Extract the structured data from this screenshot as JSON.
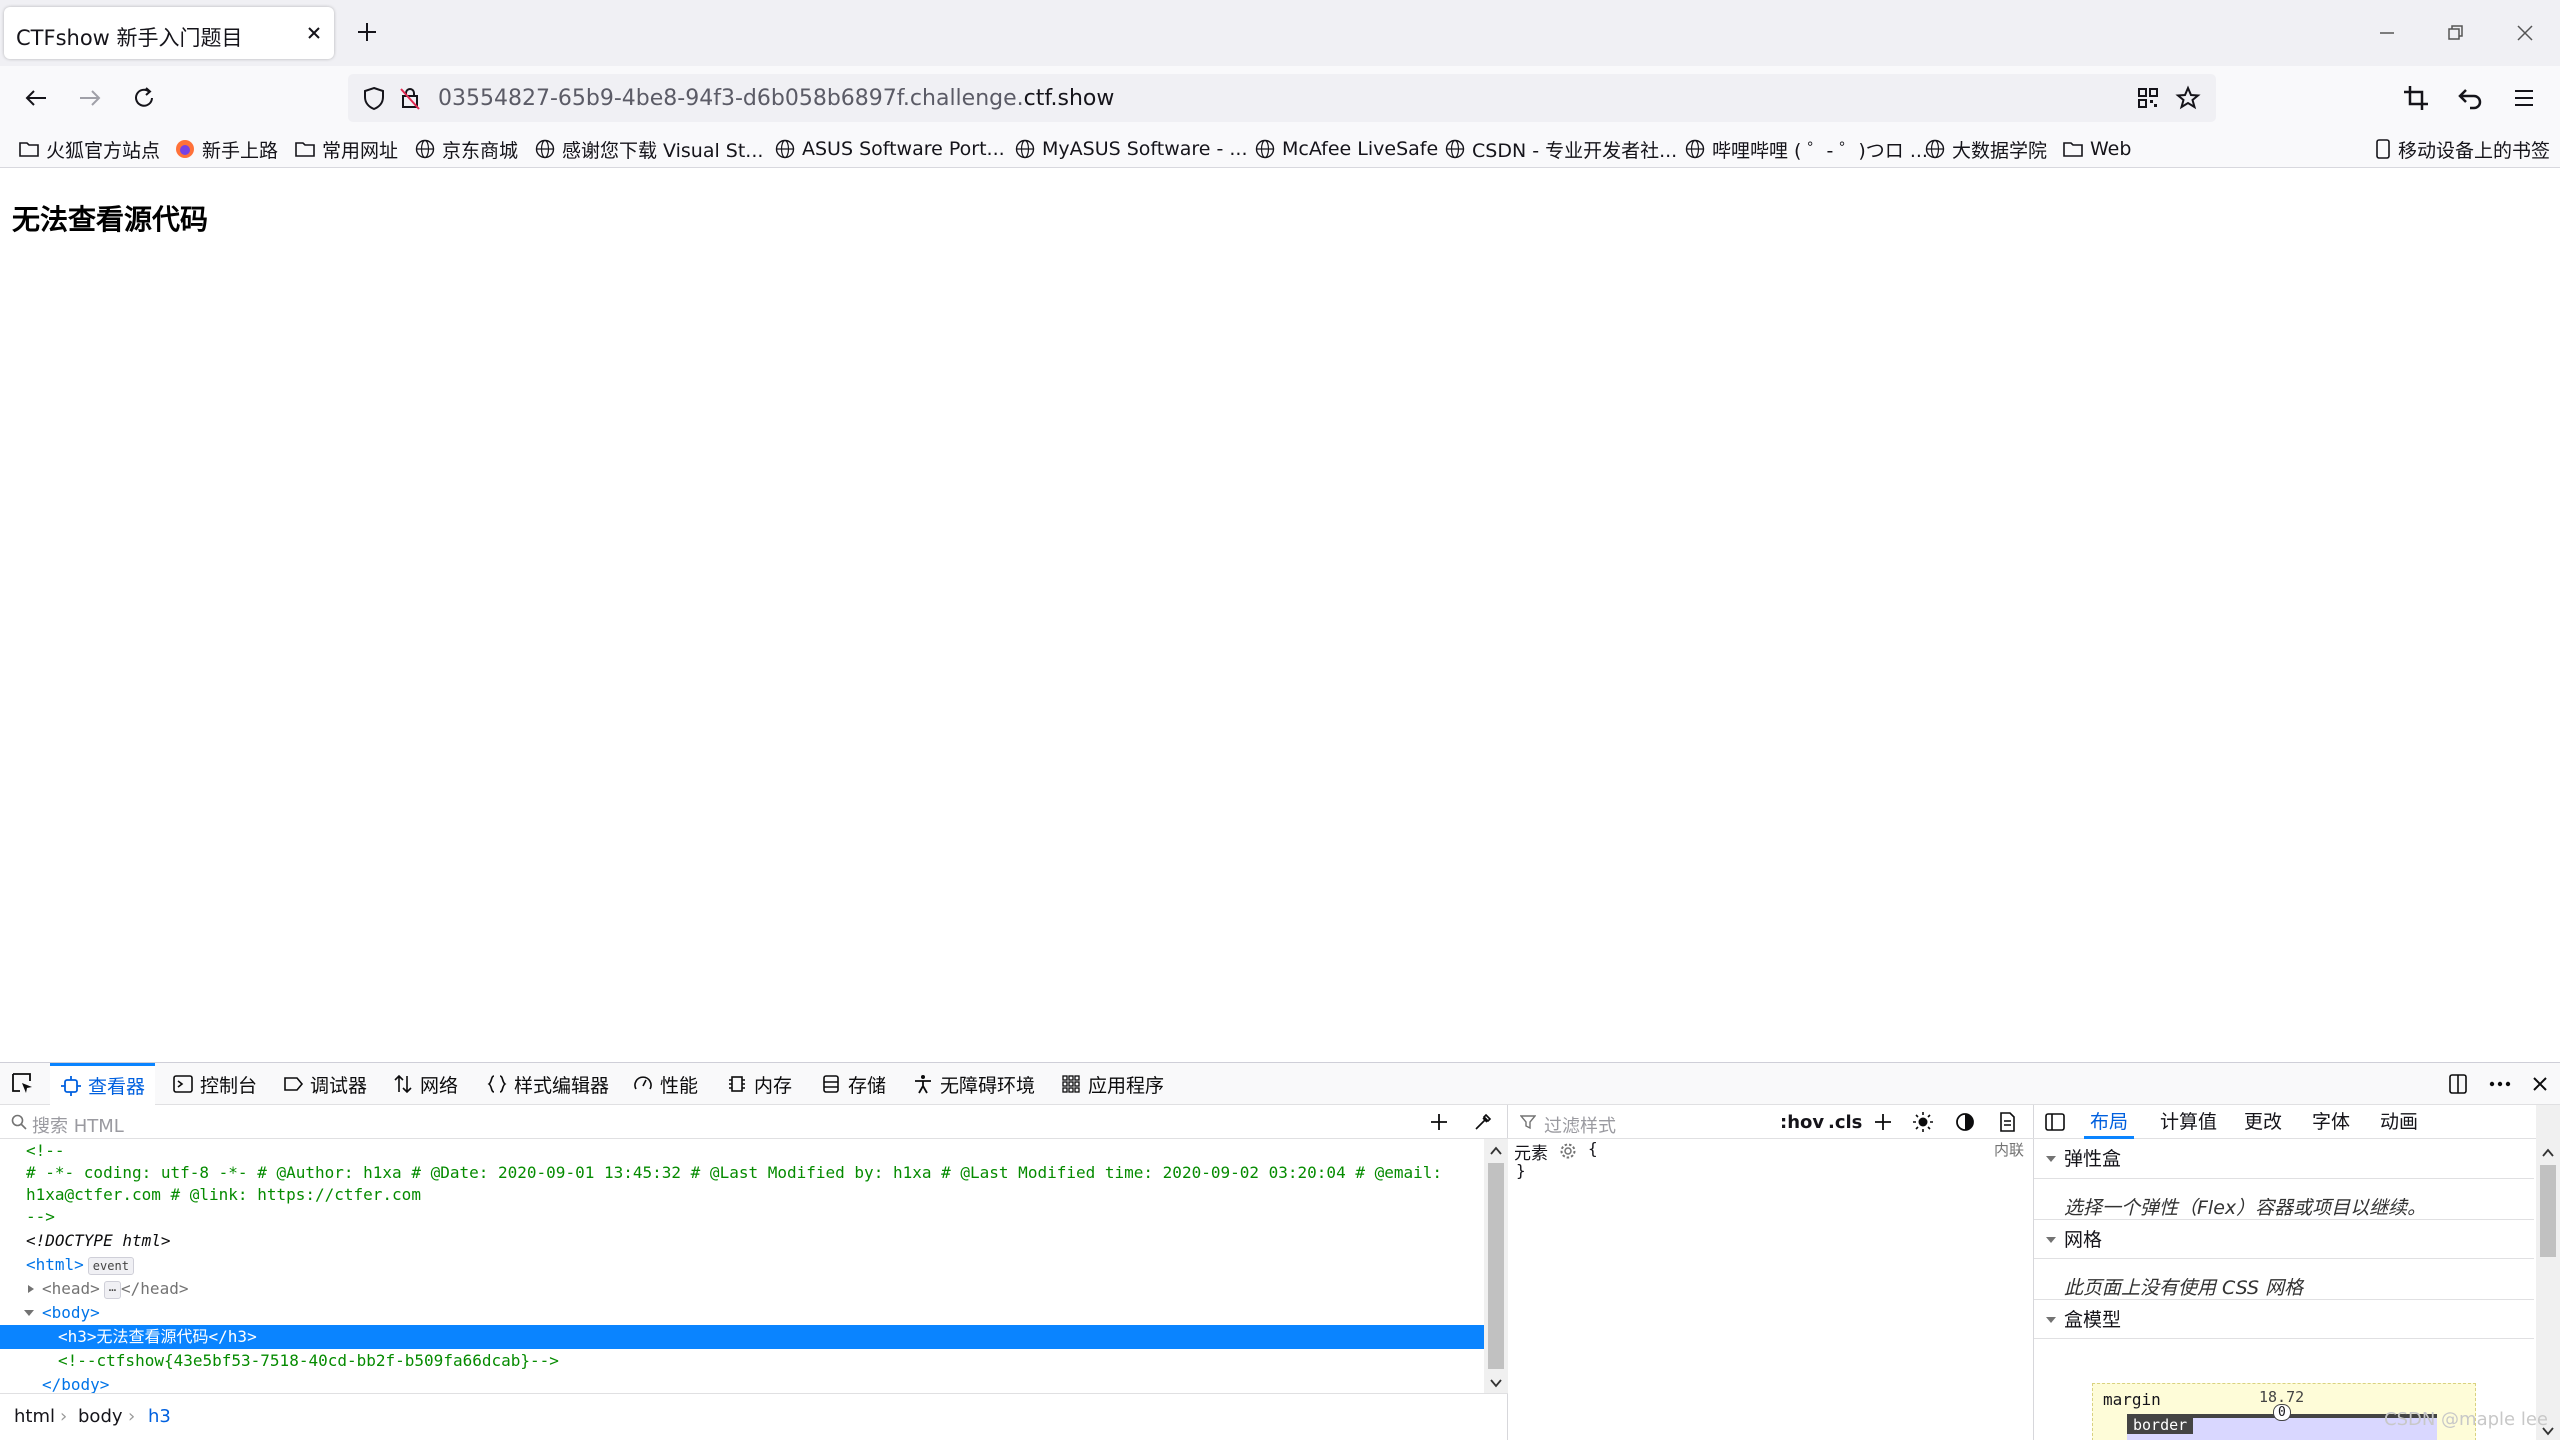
{
  "tab": {
    "title": "CTFshow 新手入门题目"
  },
  "urlbar": {
    "url_prefix": "03554827-65b9-4be8-94f3-d6b058b6897f.challenge.",
    "url_domain": "ctf.show"
  },
  "bookmarks": {
    "items": [
      "火狐官方站点",
      "新手上路",
      "常用网址",
      "京东商城",
      "感谢您下载 Visual St...",
      "ASUS Software Port...",
      "MyASUS Software - ...",
      "McAfee LiveSafe",
      "CSDN - 专业开发者社...",
      "哔哩哔哩 ( ゜- ゜)つロ ...",
      "大数据学院",
      "Web"
    ],
    "mobile": "移动设备上的书签"
  },
  "page": {
    "heading": "无法查看源代码"
  },
  "devtools": {
    "tabs": [
      "查看器",
      "控制台",
      "调试器",
      "网络",
      "样式编辑器",
      "性能",
      "内存",
      "存储",
      "无障碍环境",
      "应用程序"
    ],
    "search_placeholder": "搜索 HTML",
    "markup": {
      "comment_open": "<!--",
      "comment_line1": "# -*- coding: utf-8 -*- # @Author: h1xa # @Date: 2020-09-01 13:45:32 # @Last Modified by: h1xa # @Last Modified time: 2020-09-02 03:20:04 # @email:",
      "comment_line2": "h1xa@ctfer.com # @link: https://ctfer.com",
      "comment_close": "-->",
      "doctype": "<!DOCTYPE html>",
      "html_tag": "<html>",
      "event_badge": "event",
      "head_open": "<head>",
      "head_close": "</head>",
      "body_open": "<body>",
      "h3_line": "<h3>无法查看源代码</h3>",
      "flag_comment": "<!--ctfshow{43e5bf53-7518-40cd-bb2f-b509fa66dcab}-->",
      "body_close": "</body>"
    },
    "breadcrumbs": [
      "html",
      "body",
      "h3"
    ],
    "rules": {
      "filter_placeholder": "过滤样式",
      "hov": ":hov",
      "cls": ".cls",
      "element_label": "元素",
      "open_brace": "{",
      "close_brace": "}",
      "inline_label": "内联"
    },
    "layout": {
      "tabs": [
        "布局",
        "计算值",
        "更改",
        "字体",
        "动画"
      ],
      "flexbox_title": "弹性盒",
      "flexbox_text": "选择一个弹性（Flex）容器或项目以继续。",
      "grid_title": "网格",
      "grid_text": "此页面上没有使用 CSS 网格",
      "boxmodel_title": "盒模型",
      "margin_label": "margin",
      "margin_value": "18.72",
      "border_label": "border",
      "border_value": "0"
    }
  },
  "watermark": "CSDN @maple lee"
}
